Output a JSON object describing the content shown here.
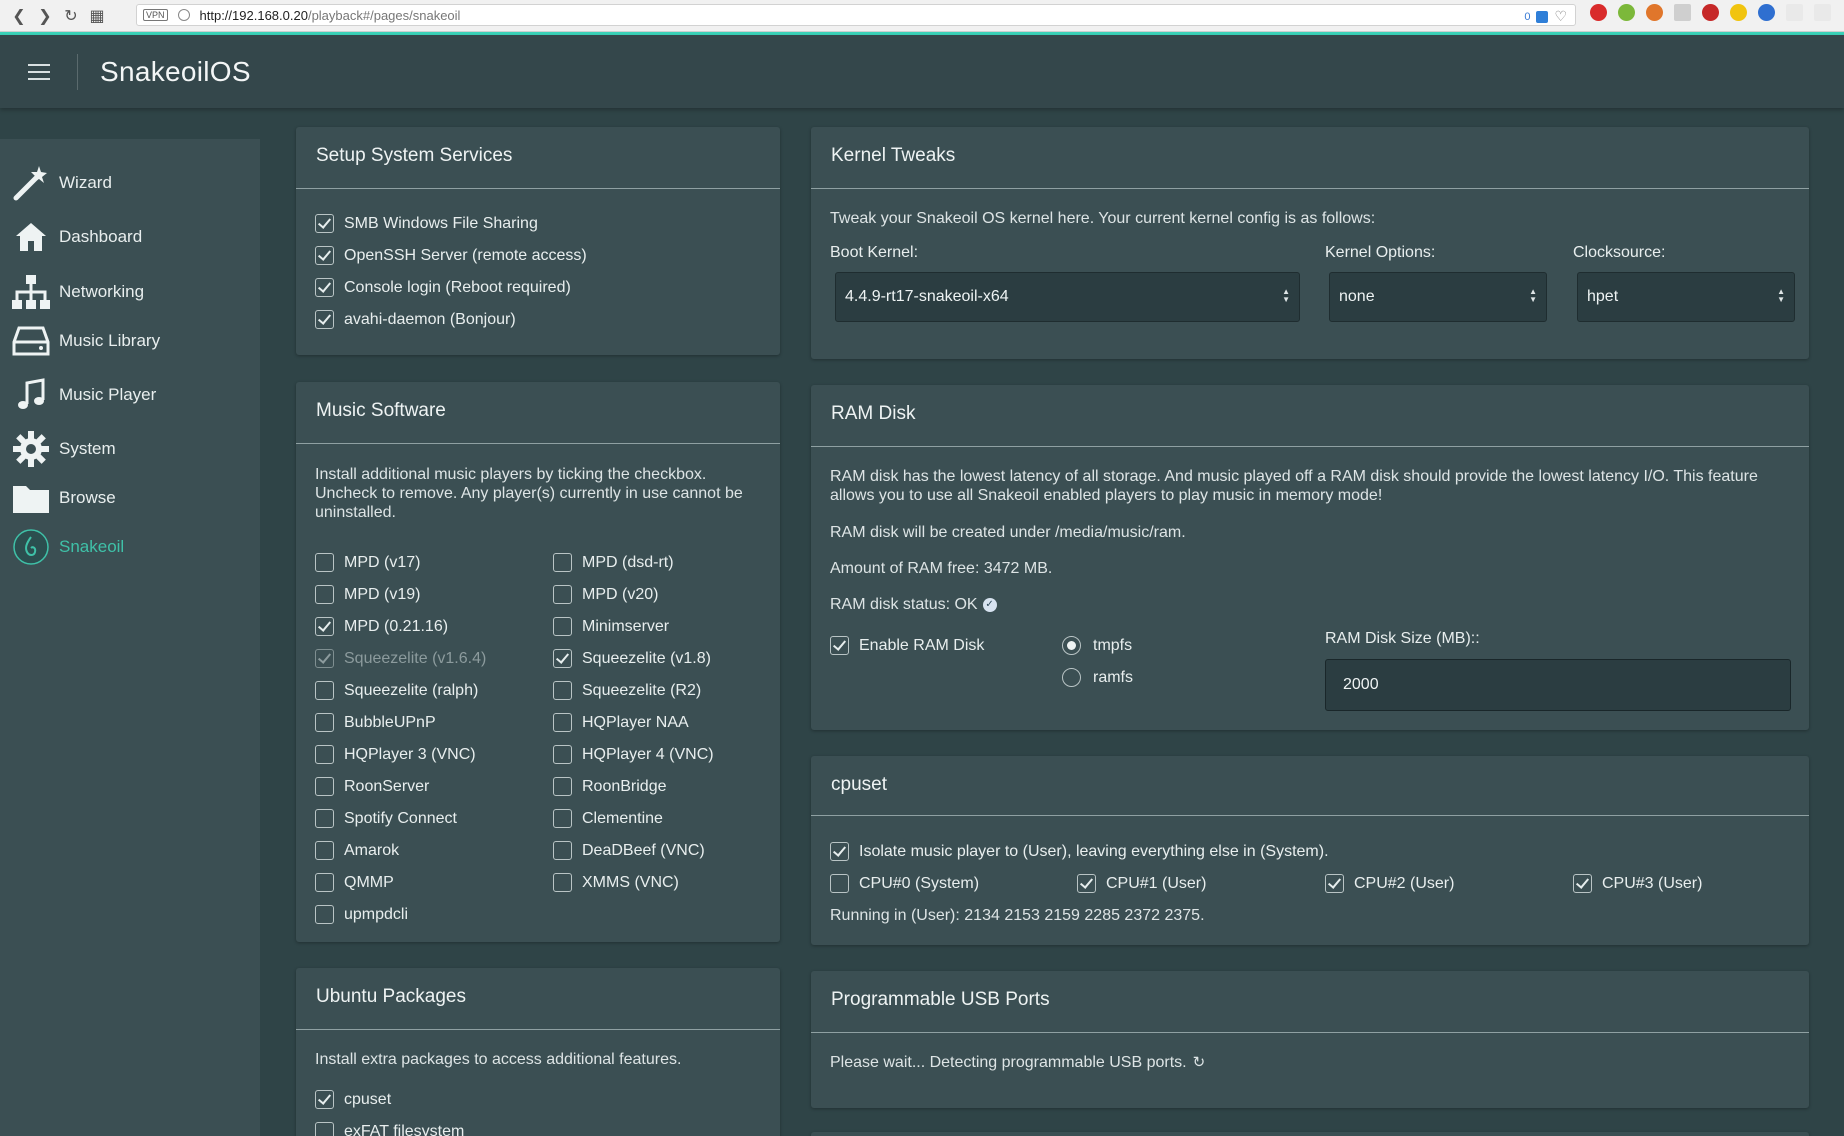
{
  "browser": {
    "vpn_badge": "VPN",
    "url_host": "http://192.168.0.20",
    "url_path": "/playback#/pages/snakeoil",
    "badge_count": "0"
  },
  "app": {
    "title": "SnakeoilOS"
  },
  "sidebar": {
    "items": [
      {
        "label": "Wizard",
        "icon": "magic-wand-icon"
      },
      {
        "label": "Dashboard",
        "icon": "home-icon"
      },
      {
        "label": "Networking",
        "icon": "network-icon"
      },
      {
        "label": "Music Library",
        "icon": "hard-drive-icon"
      },
      {
        "label": "Music Player",
        "icon": "music-note-icon"
      },
      {
        "label": "System",
        "icon": "gear-icon"
      },
      {
        "label": "Browse",
        "icon": "folder-icon"
      },
      {
        "label": "Snakeoil",
        "icon": "snakeoil-logo-icon"
      }
    ],
    "active_index": 7,
    "active_color": "#3fc1a8"
  },
  "services": {
    "title": "Setup System Services",
    "items": [
      {
        "label": "SMB Windows File Sharing",
        "checked": true
      },
      {
        "label": "OpenSSH Server (remote access)",
        "checked": true
      },
      {
        "label": "Console login (Reboot required)",
        "checked": true
      },
      {
        "label": "avahi-daemon (Bonjour)",
        "checked": true
      }
    ]
  },
  "music_software": {
    "title": "Music Software",
    "description": "Install additional music players by ticking the checkbox. Uncheck to remove. Any player(s) currently in use cannot be uninstalled.",
    "left": [
      {
        "label": "MPD (v17)",
        "checked": false
      },
      {
        "label": "MPD (v19)",
        "checked": false
      },
      {
        "label": "MPD (0.21.16)",
        "checked": true
      },
      {
        "label": "Squeezelite (v1.6.4)",
        "checked": true,
        "disabled": true
      },
      {
        "label": "Squeezelite (ralph)",
        "checked": false
      },
      {
        "label": "BubbleUPnP",
        "checked": false
      },
      {
        "label": "HQPlayer 3 (VNC)",
        "checked": false
      },
      {
        "label": "RoonServer",
        "checked": false
      },
      {
        "label": "Spotify Connect",
        "checked": false
      },
      {
        "label": "Amarok",
        "checked": false
      },
      {
        "label": "QMMP",
        "checked": false
      },
      {
        "label": "upmpdcli",
        "checked": false
      }
    ],
    "right": [
      {
        "label": "MPD (dsd-rt)",
        "checked": false
      },
      {
        "label": "MPD (v20)",
        "checked": false
      },
      {
        "label": "Minimserver",
        "checked": false
      },
      {
        "label": "Squeezelite (v1.8)",
        "checked": true
      },
      {
        "label": "Squeezelite (R2)",
        "checked": false
      },
      {
        "label": "HQPlayer NAA",
        "checked": false
      },
      {
        "label": "HQPlayer 4 (VNC)",
        "checked": false
      },
      {
        "label": "RoonBridge",
        "checked": false
      },
      {
        "label": "Clementine",
        "checked": false
      },
      {
        "label": "DeaDBeef (VNC)",
        "checked": false
      },
      {
        "label": "XMMS (VNC)",
        "checked": false
      }
    ]
  },
  "ubuntu": {
    "title": "Ubuntu Packages",
    "description": "Install extra packages to access additional features.",
    "items": [
      {
        "label": "cpuset",
        "checked": true
      },
      {
        "label": "exFAT filesystem",
        "checked": false
      }
    ]
  },
  "kernel": {
    "title": "Kernel Tweaks",
    "description": "Tweak your Snakeoil OS kernel here. Your current kernel config is as follows:",
    "boot_label": "Boot Kernel:",
    "boot_value": "4.4.9-rt17-snakeoil-x64",
    "options_label": "Kernel Options:",
    "options_value": "none",
    "clock_label": "Clocksource:",
    "clock_value": "hpet"
  },
  "ramdisk": {
    "title": "RAM Disk",
    "description": "RAM disk has the lowest latency of all storage. And music played off a RAM disk should provide the lowest latency I/O. This feature allows you to use all Snakeoil enabled players to play music in memory mode!",
    "created_under": "RAM disk will be created under /media/music/ram.",
    "free": "Amount of RAM free: 3472 MB.",
    "status": "RAM disk status: OK",
    "enable_label": "Enable RAM Disk",
    "enable_checked": true,
    "fs_options": [
      {
        "label": "tmpfs",
        "selected": true
      },
      {
        "label": "ramfs",
        "selected": false
      }
    ],
    "size_label": "RAM Disk Size (MB)::",
    "size_value": "2000"
  },
  "cpuset": {
    "title": "cpuset",
    "isolate_label": "Isolate music player to (User), leaving everything else in (System).",
    "isolate_checked": true,
    "cpus": [
      {
        "label": "CPU#0 (System)",
        "checked": false
      },
      {
        "label": "CPU#1 (User)",
        "checked": true
      },
      {
        "label": "CPU#2 (User)",
        "checked": true
      },
      {
        "label": "CPU#3 (User)",
        "checked": true
      }
    ],
    "running": "Running in (User): 2134 2153 2159 2285 2372 2375."
  },
  "usb": {
    "title": "Programmable USB Ports",
    "status": "Please wait... Detecting programmable USB ports."
  }
}
